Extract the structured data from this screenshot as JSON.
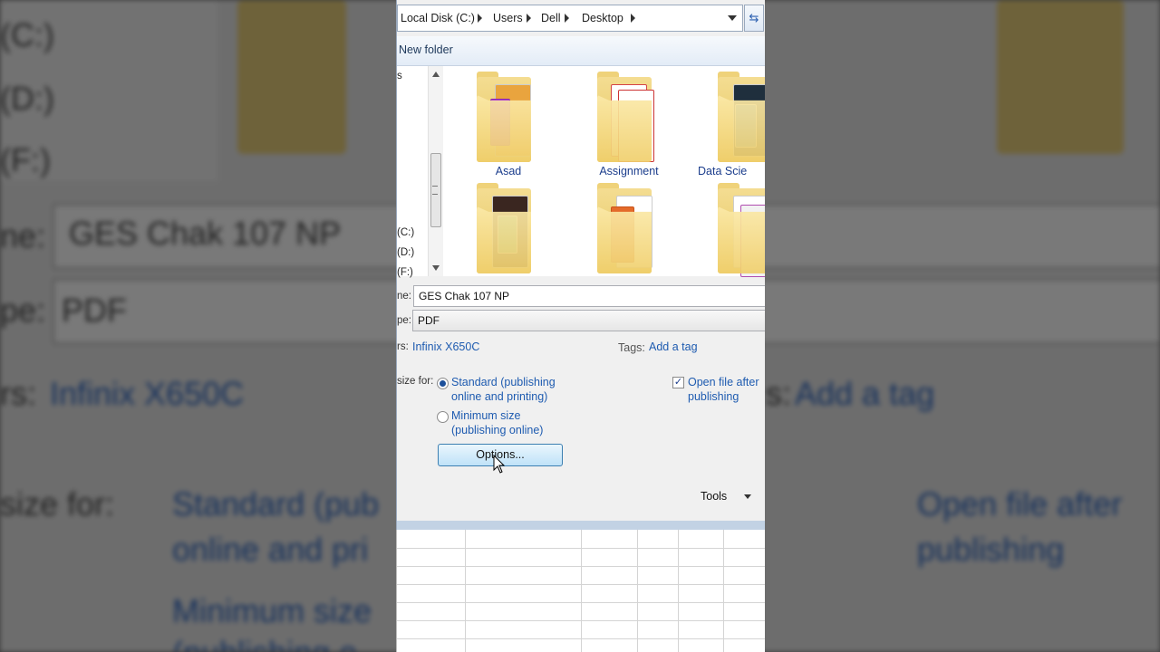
{
  "address_bar": {
    "crumbs": [
      "Local Disk (C:)",
      "Users",
      "Dell",
      "Desktop"
    ]
  },
  "toolbar": {
    "new_folder": "New folder"
  },
  "nav_pane": {
    "top_fragment": "s",
    "drives": [
      "(C:)",
      "(D:)",
      "(F:)"
    ]
  },
  "folders": [
    {
      "name": "Asad"
    },
    {
      "name": "Assignment"
    },
    {
      "name": "Data Scie"
    },
    {
      "name": ""
    },
    {
      "name": ""
    },
    {
      "name": ""
    }
  ],
  "form": {
    "filename_label": "ne:",
    "filename_value": "GES Chak 107 NP",
    "type_label": "pe:",
    "type_value": "PDF",
    "authors_label": "rs:",
    "authors_value": "Infinix X650C",
    "tags_label": "Tags:",
    "tags_value": "Add a tag",
    "optimize_label": "size for:",
    "opt_standard": "Standard (publishing online and printing)",
    "opt_minimum": "Minimum size (publishing online)",
    "open_after": "Open file after publishing",
    "options_button": "Options...",
    "tools": "Tools"
  },
  "background_zoom": {
    "drives": [
      "(C:)",
      "(D:)",
      "(F:)"
    ],
    "filename_label": "ne:",
    "filename_value": "GES Chak 107 NP",
    "type_label": "pe:",
    "type_value": "PDF",
    "authors_label": "rs:",
    "authors_value": "Infinix X650C",
    "tags_label": "s:",
    "tags_value": "Add a tag",
    "optimize_label": "size for:",
    "opt_standard_1": "Standard (pub",
    "opt_standard_2": "online and pri",
    "opt_minimum_1": "Minimum size",
    "opt_minimum_2": "(publishing o",
    "open_after_1": "Open file after",
    "open_after_2": "publishing"
  },
  "colors": {
    "link": "#1e5bb0",
    "accent": "#3c7fb1"
  }
}
